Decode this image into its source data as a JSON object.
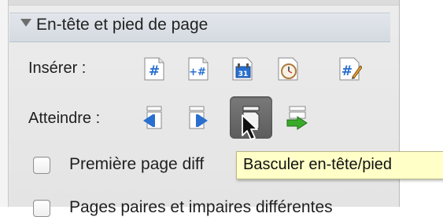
{
  "section": {
    "title": "En-tête et pied de page"
  },
  "insert_row": {
    "label": "Insérer :",
    "buttons": [
      {
        "icon": "page-number-icon"
      },
      {
        "icon": "page-count-icon"
      },
      {
        "icon": "date-icon"
      },
      {
        "icon": "time-icon"
      },
      {
        "icon": "edit-field-icon"
      }
    ]
  },
  "goto_row": {
    "label": "Atteindre :",
    "buttons": [
      {
        "icon": "previous-section-icon"
      },
      {
        "icon": "next-section-icon"
      },
      {
        "icon": "toggle-header-footer-icon"
      },
      {
        "icon": "link-to-previous-icon"
      }
    ]
  },
  "options": [
    {
      "label": "Première page diff",
      "checked": false
    },
    {
      "label": "Pages paires et impaires différentes",
      "checked": false
    }
  ],
  "tooltip": {
    "text": "Basculer en-tête/pied"
  },
  "colors": {
    "panel": "#e8e8e8",
    "header": "#d8dde4",
    "tooltip_bg": "#ffffc7",
    "icon_blue": "#2a6fd0",
    "arrow_green": "#3aaa2a"
  }
}
